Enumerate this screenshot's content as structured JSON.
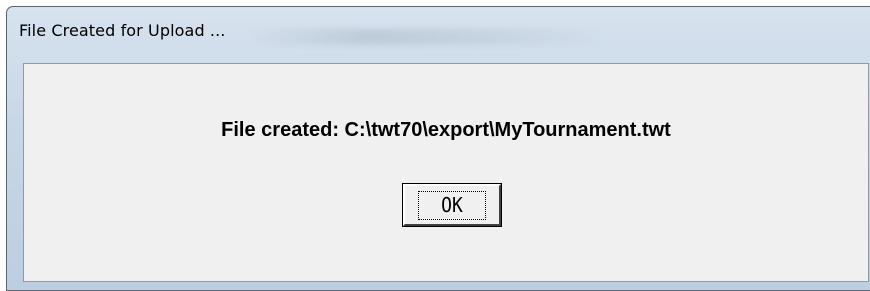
{
  "window": {
    "title": "File Created for Upload ..."
  },
  "dialog": {
    "message": "File created: C:\\twt70\\export\\MyTournament.twt",
    "ok_label": "OK"
  },
  "colors": {
    "frame": "#c8d7e7",
    "client_background": "#f0f0f0",
    "text": "#000000"
  }
}
